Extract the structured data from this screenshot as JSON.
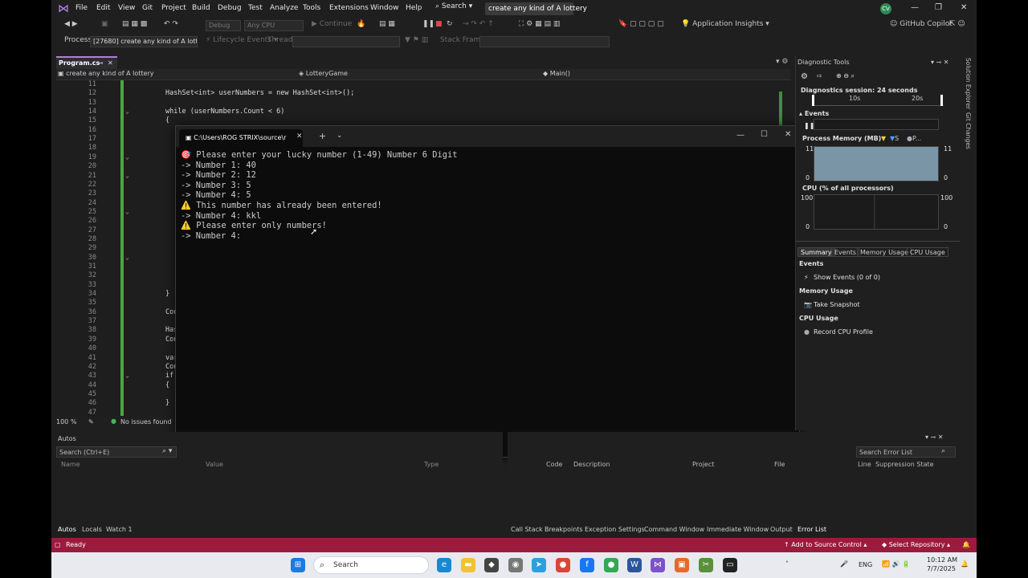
{
  "menu": {
    "items": [
      "File",
      "Edit",
      "View",
      "Git",
      "Project",
      "Build",
      "Debug",
      "Test",
      "Analyze",
      "Tools",
      "Extensions",
      "Window",
      "Help"
    ],
    "search_label": "Search",
    "solution_title": "create any kind of A lottery",
    "avatar_initials": "CV"
  },
  "toolbar": {
    "config": "Debug",
    "platform": "Any CPU",
    "continue_label": "Continue",
    "app_insights_label": "Application Insights",
    "copilot_label": "GitHub Copilot",
    "process_label": "Process:",
    "process_value": "[27680] create any kind of A lotter",
    "lifecycle_label": "Lifecycle Events",
    "thread_label": "Thread:",
    "stack_frame_label": "Stack Frame:"
  },
  "editor": {
    "tab_label": "Program.cs",
    "nav": {
      "project": "create any kind of A lottery",
      "class": "LotteryGame",
      "method": "Main()"
    },
    "lines": [
      {
        "n": "11",
        "code": ""
      },
      {
        "n": "12",
        "code": "HashSet<int> userNumbers = new HashSet<int>();"
      },
      {
        "n": "13",
        "code": ""
      },
      {
        "n": "14",
        "code": "while (userNumbers.Count < 6)"
      },
      {
        "n": "15",
        "code": "{"
      },
      {
        "n": "16",
        "code": ""
      },
      {
        "n": "17",
        "code": ""
      },
      {
        "n": "18",
        "code": ""
      },
      {
        "n": "19",
        "code": ""
      },
      {
        "n": "20",
        "code": ""
      },
      {
        "n": "21",
        "code": ""
      },
      {
        "n": "22",
        "code": ""
      },
      {
        "n": "23",
        "code": ""
      },
      {
        "n": "24",
        "code": ""
      },
      {
        "n": "25",
        "code": ""
      },
      {
        "n": "26",
        "code": ""
      },
      {
        "n": "27",
        "code": ""
      },
      {
        "n": "28",
        "code": ""
      },
      {
        "n": "29",
        "code": ""
      },
      {
        "n": "30",
        "code": ""
      },
      {
        "n": "31",
        "code": ""
      },
      {
        "n": "32",
        "code": ""
      },
      {
        "n": "33",
        "code": ""
      },
      {
        "n": "34",
        "code": "}"
      },
      {
        "n": "35",
        "code": ""
      },
      {
        "n": "36",
        "code": "Con"
      },
      {
        "n": "37",
        "code": ""
      },
      {
        "n": "38",
        "code": "Has"
      },
      {
        "n": "39",
        "code": "Con"
      },
      {
        "n": "40",
        "code": ""
      },
      {
        "n": "41",
        "code": "var"
      },
      {
        "n": "42",
        "code": "Con"
      },
      {
        "n": "43",
        "code": "if"
      },
      {
        "n": "44",
        "code": "{"
      },
      {
        "n": "45",
        "code": ""
      },
      {
        "n": "46",
        "code": "}"
      },
      {
        "n": "47",
        "code": ""
      }
    ],
    "zoom": "100 %",
    "issues": "No issues found"
  },
  "console": {
    "tab_title": "C:\\Users\\ROG STRIX\\source\\r",
    "lines": [
      "🎯 Please enter your lucky number (1-49) Number 6 Digit",
      "-> Number 1: 40",
      "-> Number 2: 12",
      "-> Number 3: 5",
      "-> Number 4: 5",
      "⚠️ This number has already been entered!",
      "-> Number 4: kkl",
      "⚠️ Please enter only numbers!",
      "-> Number 4:"
    ]
  },
  "diagnostics": {
    "title": "Diagnostic Tools",
    "session": "Diagnostics session: 24 seconds",
    "tick_10s": "10s",
    "tick_20s": "20s",
    "events_label": "Events",
    "memory_label": "Process Memory (MB)",
    "memory_legend_s": "S",
    "memory_legend_p": "P...",
    "memory_max": "11",
    "memory_min": "0",
    "cpu_label": "CPU (% of all processors)",
    "cpu_max": "100",
    "cpu_min": "0",
    "tabs": [
      "Summary",
      "Events",
      "Memory Usage",
      "CPU Usage"
    ],
    "sections": {
      "events": "Events",
      "show_events": "Show Events (0 of 0)",
      "memory": "Memory Usage",
      "snapshot": "Take Snapshot",
      "cpu": "CPU Usage",
      "record": "Record CPU Profile"
    },
    "side_solution": "Solution Explorer",
    "side_git": "Git Changes"
  },
  "autos": {
    "title": "Autos",
    "search_placeholder": "Search (Ctrl+E)",
    "columns": [
      "Name",
      "Value",
      "Type"
    ]
  },
  "errorlist": {
    "search_placeholder": "Search Error List",
    "columns": [
      "Code",
      "Description",
      "Project",
      "File",
      "Line",
      "Suppression State"
    ]
  },
  "bottom_tabs_left": [
    "Autos",
    "Locals",
    "Watch 1"
  ],
  "bottom_tabs_right": [
    "Call Stack",
    "Breakpoints",
    "Exception Settings",
    "Command Window",
    "Immediate Window",
    "Output",
    "Error List"
  ],
  "status": {
    "ready": "Ready",
    "source_control": "Add to Source Control",
    "repository": "Select Repository"
  },
  "taskbar": {
    "search_label": "Search",
    "lang": "ENG",
    "time": "10:12 AM",
    "date": "7/7/2025"
  }
}
